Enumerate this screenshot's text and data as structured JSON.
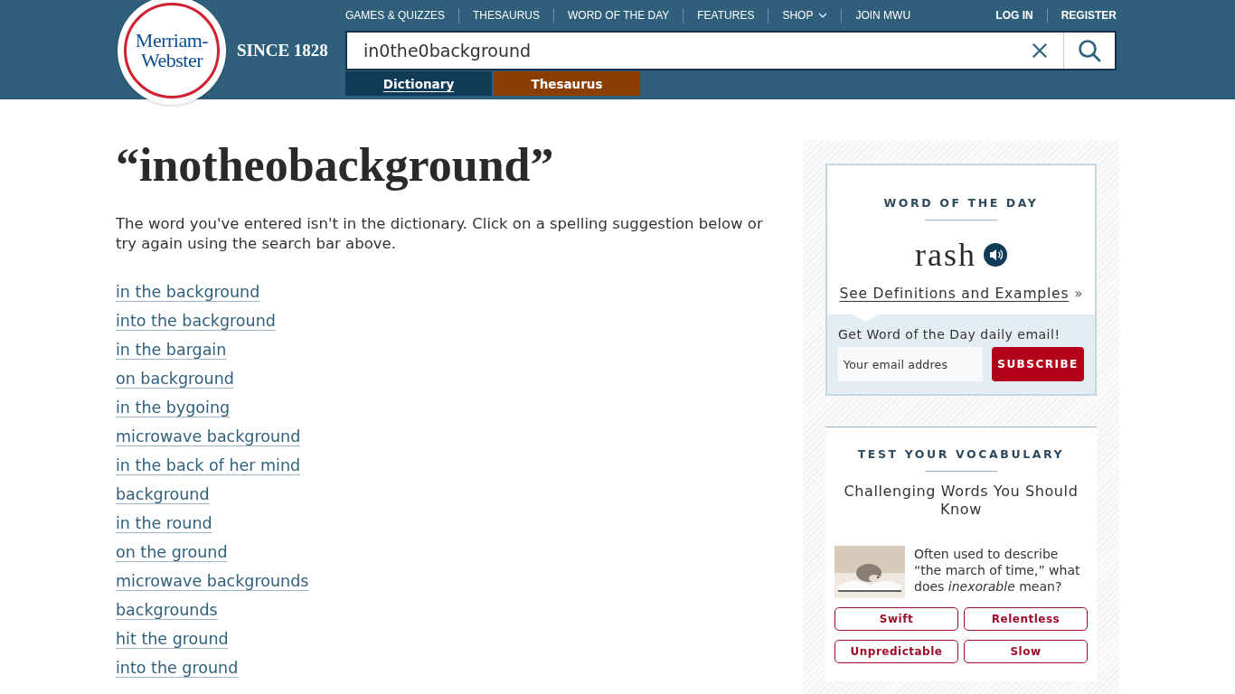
{
  "header": {
    "logo": {
      "line1": "Merriam-",
      "line2": "Webster"
    },
    "since": "SINCE 1828",
    "nav": [
      {
        "label": "GAMES & QUIZZES",
        "kind": "link"
      },
      {
        "label": "THESAURUS",
        "kind": "link"
      },
      {
        "label": "WORD OF THE DAY",
        "kind": "link"
      },
      {
        "label": "FEATURES",
        "kind": "link"
      },
      {
        "label": "SHOP",
        "kind": "dropdown"
      },
      {
        "label": "JOIN MWU",
        "kind": "link"
      }
    ],
    "account": [
      "LOG IN",
      "REGISTER"
    ],
    "search": {
      "value": "in0the0background"
    },
    "tabs": [
      {
        "label": "Dictionary",
        "selected": true,
        "color": "#0f3b57"
      },
      {
        "label": "Thesaurus",
        "selected": false,
        "color": "#8a3e04"
      }
    ]
  },
  "main": {
    "heading": "“inotheobackground”",
    "message": "The word you've entered isn't in the dictionary. Click on a spelling suggestion below or try again using the search bar above.",
    "suggestions": [
      "in the background",
      "into the background",
      "in the bargain",
      "on background",
      "in the bygoing",
      "microwave background",
      "in the back of her mind",
      "background",
      "in the round",
      "on the ground",
      "microwave backgrounds",
      "backgrounds",
      "hit the ground",
      "into the ground"
    ]
  },
  "sidebar": {
    "word_of_the_day": {
      "title": "WORD OF THE DAY",
      "word": "rash",
      "link": "See Definitions and Examples",
      "link_suffix": "»",
      "email_prompt": "Get Word of the Day daily email!",
      "email_placeholder": "Your email addres",
      "button": "SUBSCRIBE"
    },
    "quiz": {
      "title": "TEST YOUR VOCABULARY",
      "subtitle": "Challenging Words You Should Know",
      "question": "Often used to describe “the march of time,” what does *inexorable* mean?",
      "answers": [
        "Swift",
        "Relentless",
        "Unpredictable",
        "Slow"
      ]
    }
  }
}
